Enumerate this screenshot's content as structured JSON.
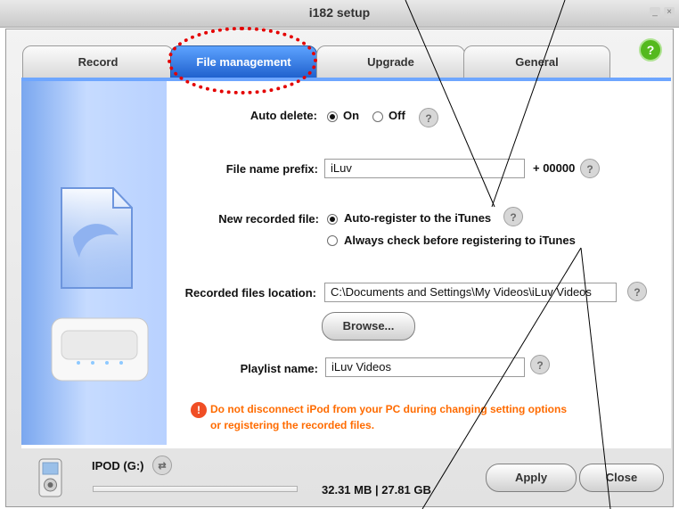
{
  "window": {
    "title": "i182 setup",
    "minimize_label": "_",
    "close_label": "×"
  },
  "tabs": [
    {
      "label": "Record"
    },
    {
      "label": "File management"
    },
    {
      "label": "Upgrade"
    },
    {
      "label": "General"
    }
  ],
  "help_label": "?",
  "form": {
    "auto_delete": {
      "label": "Auto delete:",
      "options": [
        "On",
        "Off"
      ],
      "selected": "On"
    },
    "file_name_prefix": {
      "label": "File name prefix:",
      "value": "iLuv",
      "suffix": "+ 00000"
    },
    "new_recorded_file": {
      "label": "New recorded file:",
      "options": [
        "Auto-register to the iTunes",
        "Always check before registering to iTunes"
      ],
      "selected": "Auto-register to the iTunes"
    },
    "recorded_files_location": {
      "label": "Recorded files location:",
      "value": "C:\\Documents and Settings\\My Videos\\iLuv Videos"
    },
    "browse_button": "Browse...",
    "playlist_name": {
      "label": "Playlist name:",
      "value": "iLuv Videos"
    }
  },
  "warning": {
    "icon": "!",
    "line1": "Do not disconnect iPod from your PC during changing setting options",
    "line2": "or registering the recorded files."
  },
  "device": {
    "name": "IPOD (G:)",
    "storage": "32.31 MB | 27.81 GB"
  },
  "buttons": {
    "apply": "Apply",
    "close": "Close"
  },
  "icons": {
    "help": "question-circle-icon",
    "device_refresh": "refresh-arrows-icon",
    "device": "ipod-icon",
    "warning": "exclamation-circle-icon"
  }
}
